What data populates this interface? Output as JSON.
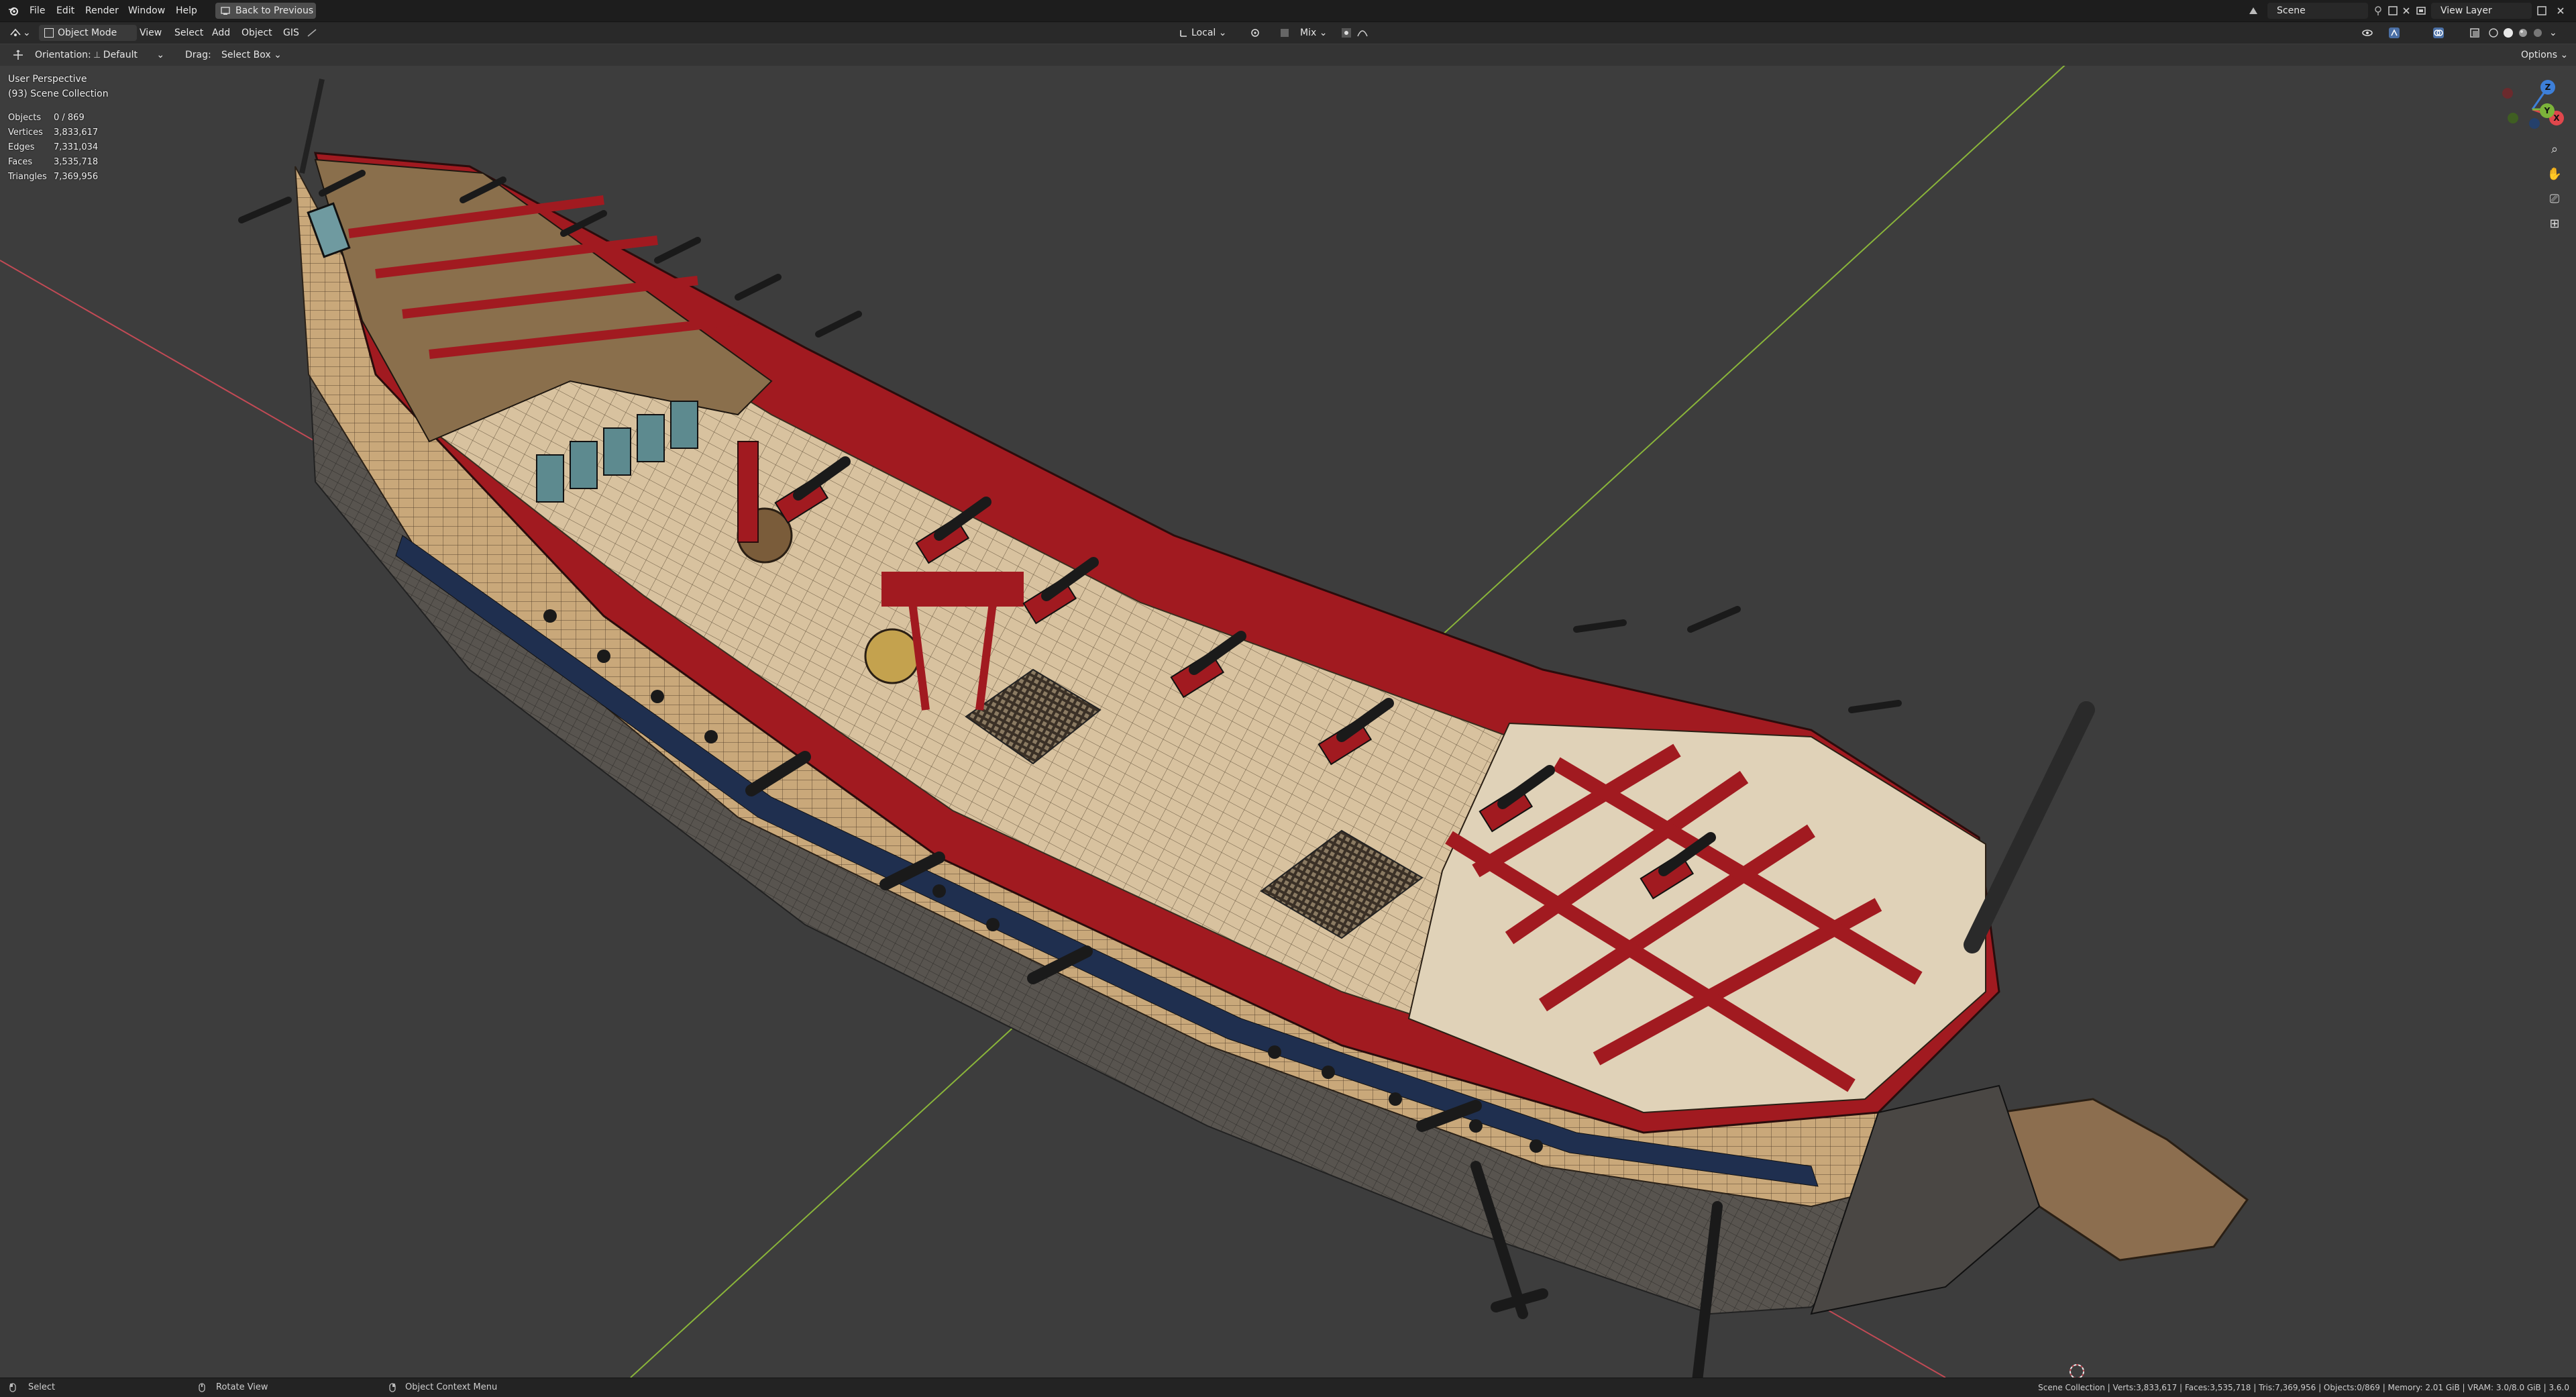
{
  "menubar": {
    "items": [
      "File",
      "Edit",
      "Render",
      "Window",
      "Help"
    ],
    "back_button": "Back to Previous",
    "scene_label": "Scene",
    "view_layer_label": "View Layer"
  },
  "viewport_header": {
    "mode": "Object Mode",
    "menus": [
      "View",
      "Select",
      "Add",
      "Object",
      "GIS"
    ],
    "transform_orientation": "Local",
    "pivot_mix": "Mix",
    "options": "Options"
  },
  "tool_settings": {
    "orientation_label": "Orientation:",
    "orientation_value": "Default",
    "drag_label": "Drag:",
    "drag_value": "Select Box"
  },
  "overlay": {
    "perspective": "User Perspective",
    "collection": "(93) Scene Collection",
    "stats": [
      {
        "label": "Objects",
        "value": "0 / 869"
      },
      {
        "label": "Vertices",
        "value": "3,833,617"
      },
      {
        "label": "Edges",
        "value": "7,331,034"
      },
      {
        "label": "Faces",
        "value": "3,535,718"
      },
      {
        "label": "Triangles",
        "value": "7,369,956"
      }
    ]
  },
  "gizmo": {
    "z": "Z",
    "x": "X",
    "y": "Y"
  },
  "statusbar": {
    "select": "Select",
    "rotate": "Rotate View",
    "context": "Object Context Menu",
    "info": "Scene Collection | Verts:3,833,617 | Faces:3,535,718 | Tris:7,369,956 | Objects:0/869 | Memory: 2.01 GiB | VRAM: 3.0/8.0 GiB | 3.6.0"
  },
  "colors": {
    "viewport_bg": "#3d3d3d",
    "hull_wood": "#c9a87a",
    "hull_red": "#a11a20",
    "hull_blue": "#1f2f4f",
    "x_axis": "#c24a55",
    "y_axis": "#8ab53a"
  }
}
